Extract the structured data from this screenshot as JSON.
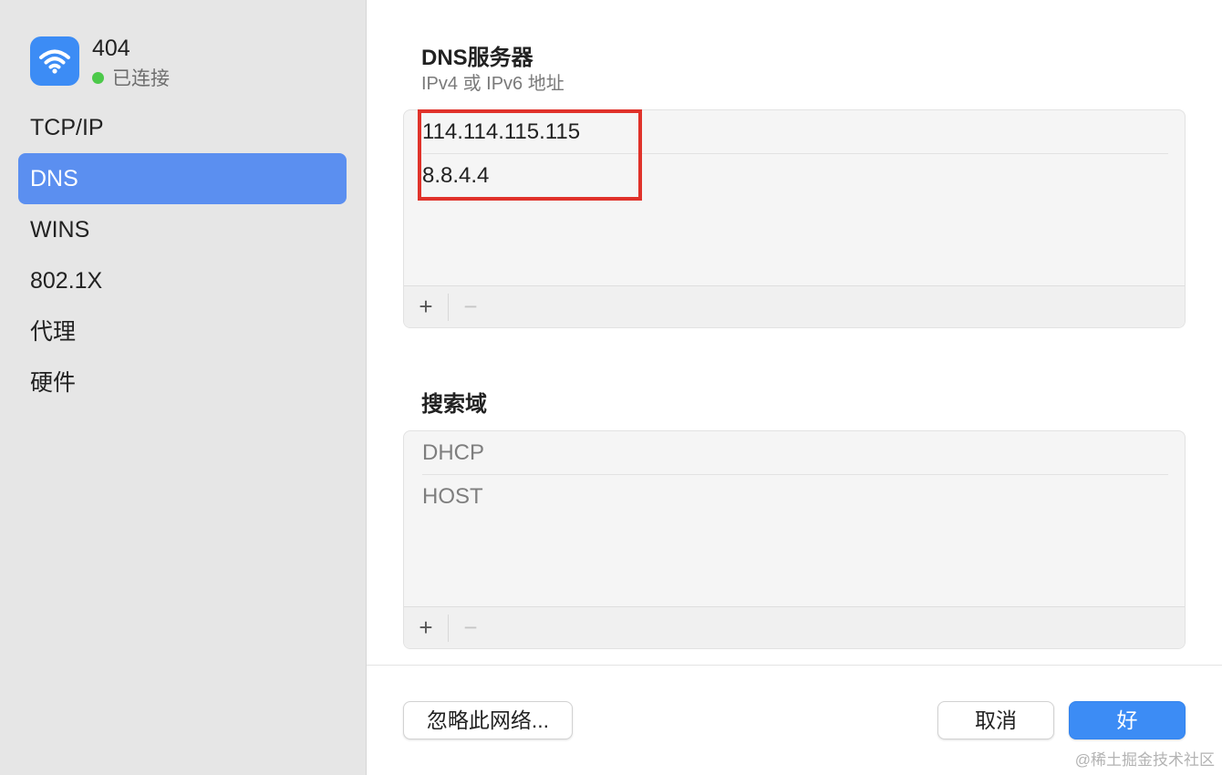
{
  "network": {
    "name": "404",
    "status": "已连接",
    "icon": "wifi-icon"
  },
  "sidebar": {
    "items": [
      {
        "label": "TCP/IP"
      },
      {
        "label": "DNS",
        "active": true
      },
      {
        "label": "WINS"
      },
      {
        "label": "802.1X"
      },
      {
        "label": "代理"
      },
      {
        "label": "硬件"
      }
    ]
  },
  "dns": {
    "title": "DNS服务器",
    "subtitle": "IPv4 或 IPv6 地址",
    "servers": [
      "114.114.115.115",
      "8.8.4.4"
    ],
    "add_label": "+",
    "remove_label": "−"
  },
  "search_domains": {
    "title": "搜索域",
    "entries": [
      "DHCP",
      "HOST"
    ],
    "add_label": "+",
    "remove_label": "−"
  },
  "footer": {
    "ignore_label": "忽略此网络...",
    "cancel_label": "取消",
    "ok_label": "好"
  },
  "watermark": "@稀土掘金技术社区",
  "colors": {
    "accent": "#3c8cf5",
    "sidebar_active": "#5b8ff0",
    "status_connected": "#4cc94a",
    "highlight": "#e0322a"
  }
}
